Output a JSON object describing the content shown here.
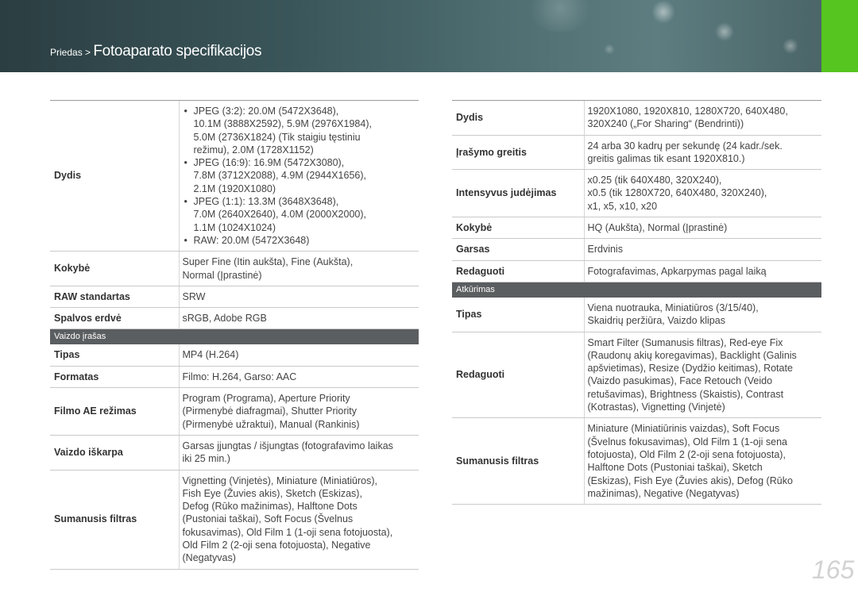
{
  "header": {
    "crumb_small": "Priedas > ",
    "crumb_title": "Fotoaparato specifikacijos",
    "accent_color": "#57c51f"
  },
  "left": {
    "dydis_label": "Dydis",
    "dydis_b1": [
      "JPEG (3:2): 20.0M (5472X3648),",
      "10.1M (3888X2592), 5.9M (2976X1984),",
      "5.0M (2736X1824) (Tik staigiu tęstiniu",
      "režimu), 2.0M (1728X1152)"
    ],
    "dydis_b2": [
      "JPEG (16:9): 16.9M (5472X3080),",
      "7.8M (3712X2088), 4.9M (2944X1656),",
      "2.1M (1920X1080)"
    ],
    "dydis_b3": [
      "JPEG (1:1): 13.3M (3648X3648),",
      "7.0M (2640X2640), 4.0M (2000X2000),",
      "1.1M (1024X1024)"
    ],
    "dydis_b4": [
      "RAW: 20.0M (5472X3648)"
    ],
    "kokybe_label": "Kokybė",
    "kokybe_val": [
      "Super Fine (Itin aukšta), Fine (Aukšta),",
      "Normal (Įprastinė)"
    ],
    "raw_label": "RAW standartas",
    "raw_val": "SRW",
    "spalvos_label": "Spalvos erdvė",
    "spalvos_val": "sRGB, Adobe RGB",
    "section_video": "Vaizdo įrašas",
    "tipas_label": "Tipas",
    "tipas_val": "MP4 (H.264)",
    "formatas_label": "Formatas",
    "formatas_val": "Filmo: H.264, Garso: AAC",
    "filmoae_label": "Filmo AE režimas",
    "filmoae_val": [
      "Program (Programa), Aperture Priority",
      "(Pirmenybė diafragmai), Shutter Priority",
      "(Pirmenybė užraktui), Manual (Rankinis)"
    ],
    "iskarpa_label": "Vaizdo iškarpa",
    "iskarpa_val": [
      "Garsas įjungtas / išjungtas (fotografavimo laikas",
      "iki 25 min.)"
    ],
    "filtras_label": "Sumanusis filtras",
    "filtras_val": [
      "Vignetting (Vinjetės), Miniature (Miniatiūros),",
      "Fish Eye (Žuvies akis), Sketch (Eskizas),",
      "Defog (Rūko mažinimas), Halftone Dots",
      "(Pustoniai taškai), Soft Focus (Švelnus",
      "fokusavimas), Old Film 1 (1-oji sena fotojuosta),",
      "Old Film 2 (2-oji sena fotojuosta), Negative",
      "(Negatyvas)"
    ]
  },
  "right": {
    "dydis_label": "Dydis",
    "dydis_val": [
      "1920X1080, 1920X810, 1280X720, 640X480,",
      "320X240 („For Sharing“ (Bendrinti))"
    ],
    "irasymo_label": "Įrašymo greitis",
    "irasymo_val": [
      "24 arba 30 kadrų per sekundę (24 kadr./sek.",
      "greitis galimas tik esant 1920X810.)"
    ],
    "intensyvus_label": "Intensyvus judėjimas",
    "intensyvus_val": [
      "x0.25 (tik 640X480, 320X240),",
      "x0.5 (tik 1280X720, 640X480, 320X240),",
      "x1, x5, x10, x20"
    ],
    "kokybe_label": "Kokybė",
    "kokybe_val": "HQ (Aukšta), Normal (Įprastinė)",
    "garsas_label": "Garsas",
    "garsas_val": "Erdvinis",
    "redaguoti_label": "Redaguoti",
    "redaguoti_val": "Fotografavimas, Apkarpymas pagal laiką",
    "section_atkurimas": "Atkūrimas",
    "tipas_label": "Tipas",
    "tipas_val": [
      "Viena nuotrauka, Miniatiūros (3/15/40),",
      "Skaidrių peržiūra, Vaizdo klipas"
    ],
    "redaguoti2_label": "Redaguoti",
    "redaguoti2_val": [
      "Smart Filter (Sumanusis filtras), Red-eye Fix",
      "(Raudonų akių koregavimas), Backlight (Galinis",
      "apšvietimas), Resize (Dydžio keitimas), Rotate",
      "(Vaizdo pasukimas), Face Retouch (Veido",
      "retušavimas), Brightness (Skaistis), Contrast",
      "(Kotrastas), Vignetting (Vinjetė)"
    ],
    "filtras_label": "Sumanusis filtras",
    "filtras_val": [
      "Miniature (Miniatiūrinis vaizdas), Soft Focus",
      "(Švelnus fokusavimas), Old Film 1 (1-oji sena",
      "fotojuosta), Old Film 2 (2-oji sena fotojuosta),",
      "Halftone Dots (Pustoniai taškai), Sketch",
      "(Eskizas), Fish Eye (Žuvies akis), Defog (Rūko",
      "mažinimas), Negative (Negatyvas)"
    ]
  },
  "page_number": "165"
}
